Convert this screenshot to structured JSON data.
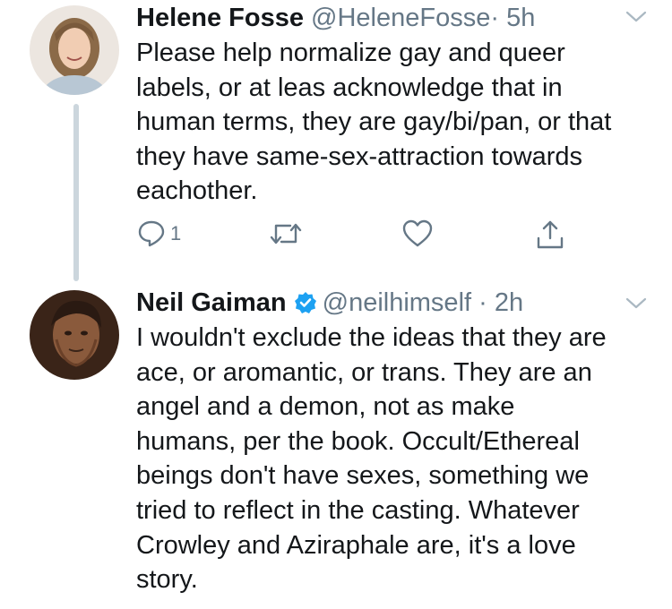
{
  "tweet1": {
    "display_name": "Helene Fosse",
    "handle": "@HeleneFosse",
    "separator": "·",
    "time": "5h",
    "lines": [
      "Please help normalize gay and queer",
      "labels, or at leas acknowledge that in",
      "human terms, they are gay/bi/pan, or that",
      "they have same-sex-attraction towards",
      "eachother."
    ],
    "reply_count": "1",
    "icons": [
      "reply-icon",
      "retweet-icon",
      "like-icon",
      "share-icon",
      "chevron-down-icon"
    ]
  },
  "tweet2": {
    "display_name": "Neil Gaiman",
    "verified": true,
    "handle": "@neilhimself",
    "separator": "·",
    "time": "2h",
    "lines": [
      "I wouldn't exclude the ideas that they are",
      "ace, or aromantic, or trans. They are an",
      "angel and a demon, not as make",
      "humans, per the book. Occult/Ethereal",
      "beings don't have sexes, something we",
      "tried to reflect in the casting. Whatever",
      "Crowley and Aziraphale are, it's a love",
      "story."
    ]
  },
  "colors": {
    "text": "#14171a",
    "secondary": "#657786",
    "verified": "#1da1f2",
    "thread_line": "#ccd6dd"
  }
}
